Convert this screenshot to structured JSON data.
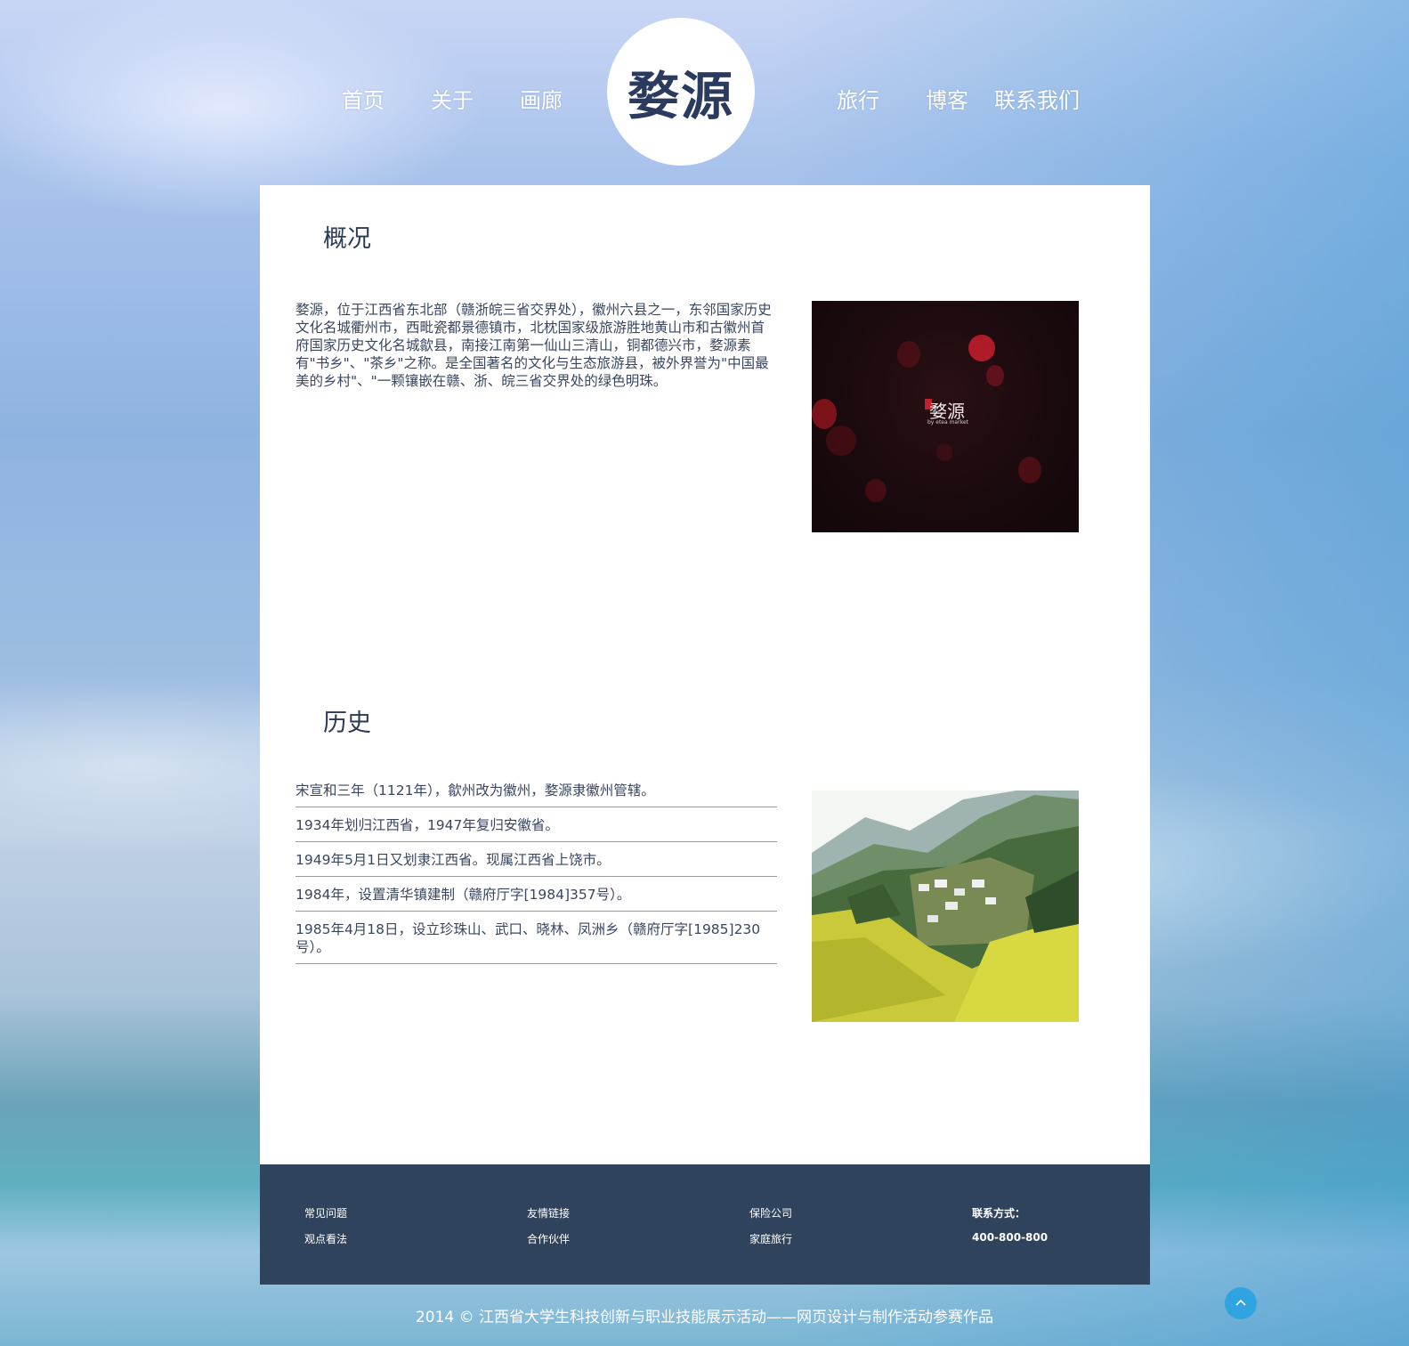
{
  "nav": {
    "left": [
      {
        "label": "首页"
      },
      {
        "label": "关于"
      },
      {
        "label": "画廊"
      }
    ],
    "right": [
      {
        "label": "旅行"
      },
      {
        "label": "博客"
      },
      {
        "label": "联系我们"
      }
    ],
    "logo_text": "婺源"
  },
  "overview": {
    "title": "概况",
    "text": "婺源，位于江西省东北部（赣浙皖三省交界处），徽州六县之一，东邻国家历史文化名城衢州市，西毗瓷都景德镇市，北枕国家级旅游胜地黄山市和古徽州首府国家历史文化名城歙县，南接江南第一仙山三清山，铜都德兴市，婺源素有\"书乡\"、\"茶乡\"之称。是全国著名的文化与生态旅游县，被外界誉为\"中国最美的乡村\"、\"一颗镶嵌在赣、浙、皖三省交界处的绿色明珠。",
    "image_caption": "婺源",
    "image_subcaption": "by etea market"
  },
  "history": {
    "title": "历史",
    "items": [
      "宋宣和三年（1121年），歙州改为徽州，婺源隶徽州管辖。",
      "1934年划归江西省，1947年复归安徽省。",
      "1949年5月1日又划隶江西省。现属江西省上饶市。",
      "1984年，设置清华镇建制（赣府厅字[1984]357号）。",
      "1985年4月18日，设立珍珠山、武口、晓林、凤洲乡（赣府厅字[1985]230号）。"
    ]
  },
  "footer": {
    "col1": [
      "常见问题",
      "观点看法"
    ],
    "col2": [
      "友情链接",
      "合作伙伴"
    ],
    "col3": [
      "保险公司",
      "家庭旅行"
    ],
    "contact_label": "联系方式：",
    "contact_phone": "400-800-800"
  },
  "copyright": "2014 © 江西省大学生科技创新与职业技能展示活动——网页设计与制作活动参赛作品",
  "icons": {
    "back_to_top": "chevron-up-icon"
  },
  "colors": {
    "footer_bg": "#30435c",
    "title": "#2c3a55",
    "back_to_top": "#2fa4e0"
  }
}
